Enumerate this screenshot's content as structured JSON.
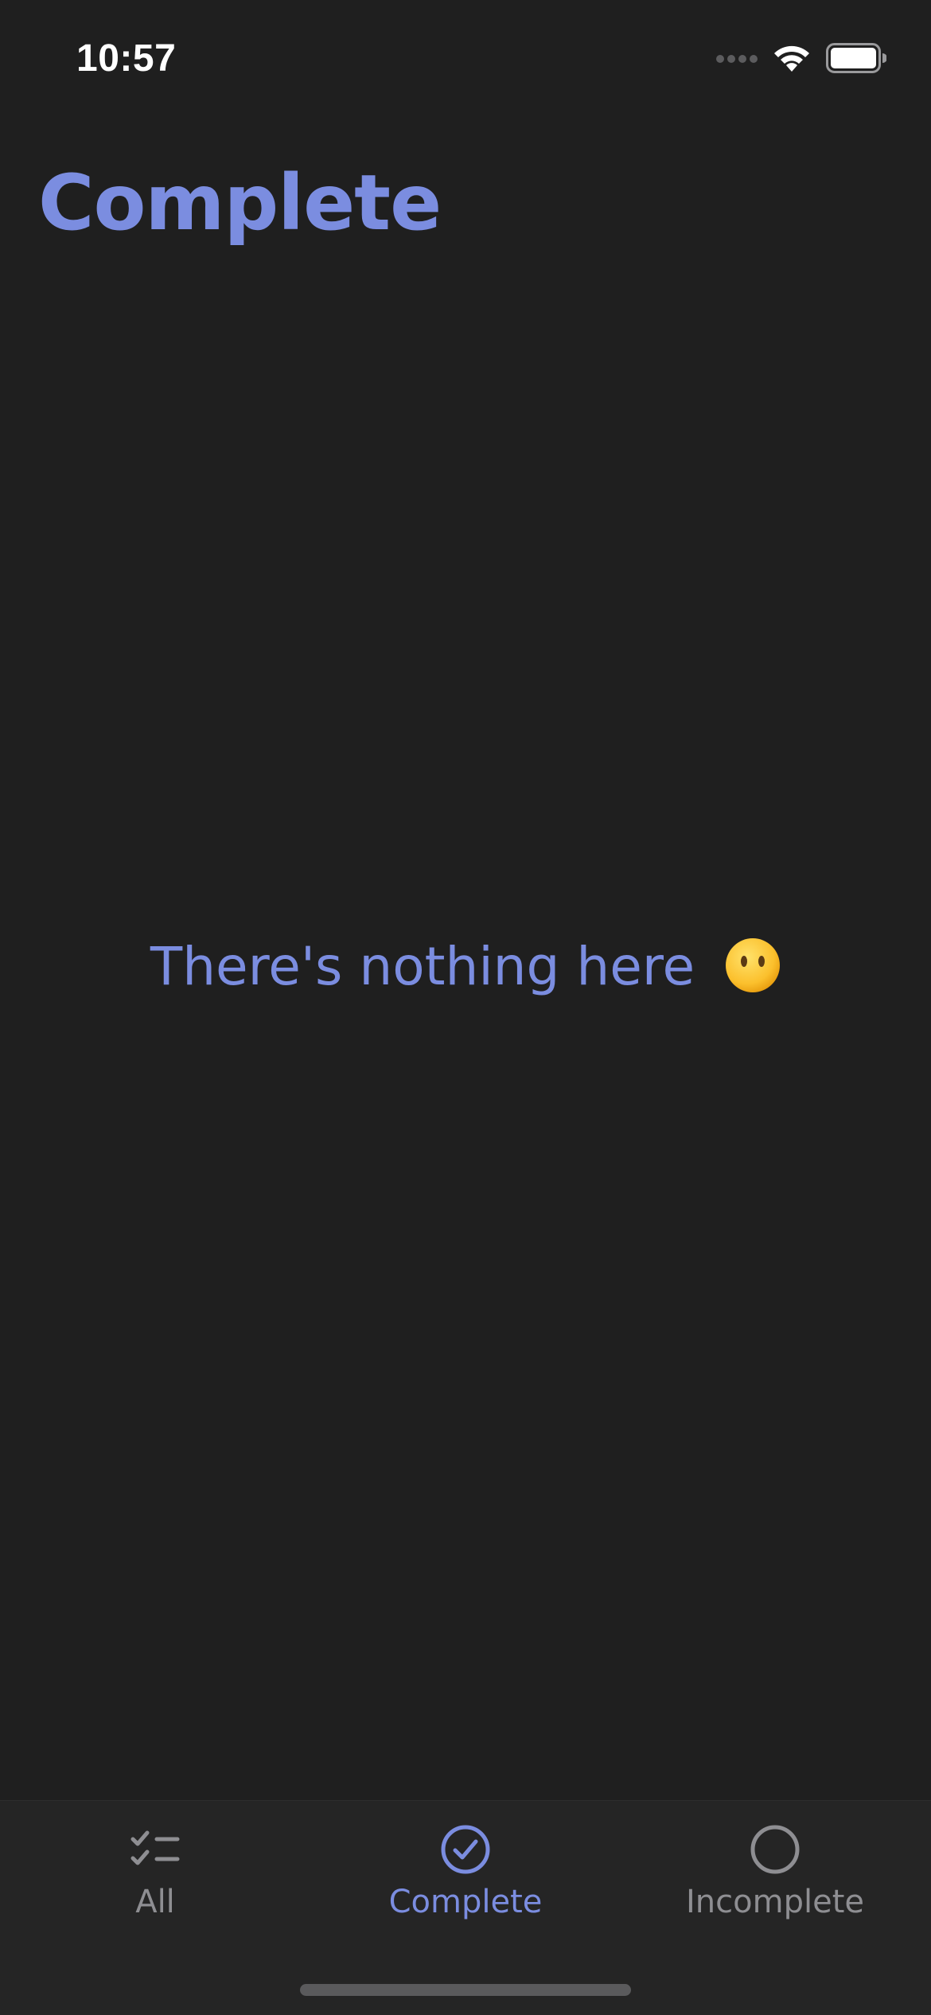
{
  "status_bar": {
    "time": "10:57"
  },
  "header": {
    "title": "Complete"
  },
  "empty_state": {
    "message": "There's nothing here",
    "emoji": "😶"
  },
  "tab_bar": {
    "tabs": [
      {
        "label": "All",
        "icon": "checklist-icon",
        "active": false
      },
      {
        "label": "Complete",
        "icon": "checkmark-circle-icon",
        "active": true
      },
      {
        "label": "Incomplete",
        "icon": "circle-icon",
        "active": false
      }
    ]
  },
  "colors": {
    "accent": "#7b8de0",
    "background": "#1f1f1f",
    "tab_bar_background": "#252525",
    "inactive": "#8e8e92"
  }
}
